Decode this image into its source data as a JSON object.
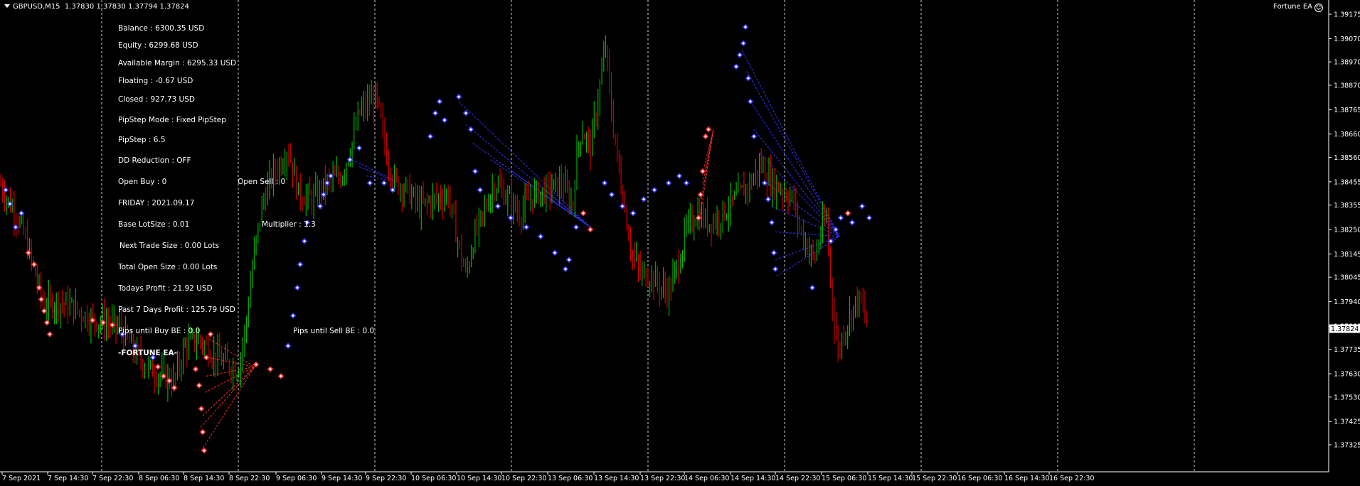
{
  "header": {
    "symbol": "GBPUSD,M15",
    "ohlc": "1.37830 1.37830 1.37794 1.37824",
    "ea_name": "Fortune EA"
  },
  "info_panel": {
    "balance": "Balance : 6300.35 USD",
    "equity": "Equity : 6299.68 USD",
    "available_margin": "Available Margin : 6295.33 USD",
    "floating": "Floating : -0.67 USD",
    "closed": "Closed : 927.73 USD",
    "pipstep_mode": "PipStep Mode : Fixed PipStep",
    "pipstep": "PipStep : 6.5",
    "dd_reduction": "DD Reduction : OFF",
    "open_buy": "Open Buy : 0",
    "open_sell": "Open Sell : 0",
    "date": "FRIDAY : 2021.09.17",
    "base_lot": "Base LotSize : 0.01",
    "multiplier": "Multiplier : 1.3",
    "next_trade": "Next Trade Size : 0.00 Lots",
    "total_open": "Total Open Size : 0.00 Lots",
    "todays_profit": "Todays Profit : 21.92 USD",
    "past7": "Past 7 Days Profit : 125.79 USD",
    "pips_buy_be": "Pips until Buy BE : 0.0",
    "pips_sell_be": "Pips until Sell BE : 0.0",
    "brand": "-FORTUNE EA-"
  },
  "chart_data": {
    "type": "candlestick",
    "price_axis": [
      "1.39175",
      "1.39070",
      "1.38970",
      "1.38870",
      "1.38765",
      "1.38660",
      "1.38560",
      "1.38455",
      "1.38355",
      "1.38250",
      "1.38145",
      "1.38045",
      "1.37940",
      "1.37835",
      "1.37735",
      "1.37630",
      "1.37530",
      "1.37425",
      "1.37325"
    ],
    "current_price": "1.37824",
    "time_axis": [
      "7 Sep 2021",
      "7 Sep 14:30",
      "7 Sep 22:30",
      "8 Sep 06:30",
      "8 Sep 14:30",
      "8 Sep 22:30",
      "9 Sep 06:30",
      "9 Sep 14:30",
      "9 Sep 22:30",
      "10 Sep 06:30",
      "10 Sep 14:30",
      "10 Sep 22:30",
      "13 Sep 06:30",
      "13 Sep 14:30",
      "13 Sep 22:30",
      "14 Sep 06:30",
      "14 Sep 14:30",
      "14 Sep 22:30",
      "15 Sep 06:30",
      "15 Sep 14:30",
      "15 Sep 22:30",
      "16 Sep 06:30",
      "16 Sep 14:30",
      "16 Sep 22:30"
    ],
    "close_path": [
      [
        0,
        1.3845
      ],
      [
        10,
        1.3838
      ],
      [
        22,
        1.3832
      ],
      [
        35,
        1.3822
      ],
      [
        50,
        1.3805
      ],
      [
        62,
        1.3792
      ],
      [
        80,
        1.3794
      ],
      [
        100,
        1.3792
      ],
      [
        125,
        1.3787
      ],
      [
        150,
        1.3785
      ],
      [
        170,
        1.3782
      ],
      [
        190,
        1.3772
      ],
      [
        210,
        1.3765
      ],
      [
        228,
        1.3762
      ],
      [
        245,
        1.376
      ],
      [
        260,
        1.3775
      ],
      [
        280,
        1.3778
      ],
      [
        300,
        1.3771
      ],
      [
        320,
        1.3767
      ],
      [
        335,
        1.3765
      ],
      [
        345,
        1.3782
      ],
      [
        355,
        1.381
      ],
      [
        368,
        1.3835
      ],
      [
        382,
        1.3848
      ],
      [
        395,
        1.3854
      ],
      [
        405,
        1.386
      ],
      [
        420,
        1.384
      ],
      [
        440,
        1.3838
      ],
      [
        460,
        1.3845
      ],
      [
        480,
        1.3848
      ],
      [
        495,
        1.3862
      ],
      [
        505,
        1.3875
      ],
      [
        520,
        1.388
      ],
      [
        528,
        1.3882
      ],
      [
        535,
        1.3872
      ],
      [
        545,
        1.3855
      ],
      [
        555,
        1.3845
      ],
      [
        570,
        1.3843
      ],
      [
        590,
        1.3835
      ],
      [
        610,
        1.3838
      ],
      [
        630,
        1.384
      ],
      [
        645,
        1.3818
      ],
      [
        655,
        1.3805
      ],
      [
        665,
        1.382
      ],
      [
        680,
        1.3832
      ],
      [
        695,
        1.3845
      ],
      [
        710,
        1.384
      ],
      [
        730,
        1.3832
      ],
      [
        750,
        1.384
      ],
      [
        770,
        1.3842
      ],
      [
        790,
        1.3845
      ],
      [
        805,
        1.3835
      ],
      [
        812,
        1.386
      ],
      [
        818,
        1.3868
      ],
      [
        830,
        1.386
      ],
      [
        845,
        1.389
      ],
      [
        852,
        1.3905
      ],
      [
        858,
        1.388
      ],
      [
        868,
        1.3855
      ],
      [
        878,
        1.3835
      ],
      [
        888,
        1.3815
      ],
      [
        900,
        1.3806
      ],
      [
        915,
        1.3805
      ],
      [
        930,
        1.38
      ],
      [
        940,
        1.3798
      ],
      [
        955,
        1.3812
      ],
      [
        965,
        1.3825
      ],
      [
        980,
        1.3832
      ],
      [
        995,
        1.3828
      ],
      [
        1010,
        1.383
      ],
      [
        1025,
        1.3835
      ],
      [
        1040,
        1.384
      ],
      [
        1055,
        1.3845
      ],
      [
        1070,
        1.3853
      ],
      [
        1085,
        1.3845
      ],
      [
        1100,
        1.3842
      ],
      [
        1115,
        1.3838
      ],
      [
        1125,
        1.3825
      ],
      [
        1135,
        1.3818
      ],
      [
        1145,
        1.3812
      ],
      [
        1155,
        1.3825
      ],
      [
        1162,
        1.383
      ],
      [
        1168,
        1.38
      ],
      [
        1172,
        1.3788
      ],
      [
        1178,
        1.3772
      ],
      [
        1185,
        1.378
      ],
      [
        1195,
        1.3788
      ],
      [
        1205,
        1.3795
      ],
      [
        1213,
        1.3792
      ],
      [
        1220,
        1.3782
      ]
    ]
  }
}
